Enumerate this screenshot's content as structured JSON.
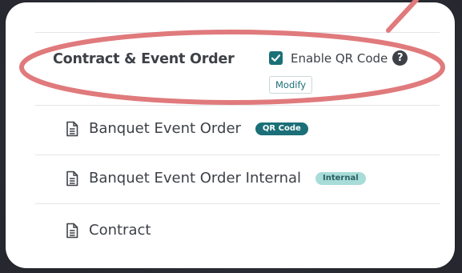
{
  "section": {
    "title": "Contract & Event Order",
    "qr_checkbox_label": "Enable QR Code",
    "qr_checked": true,
    "help_icon": "?",
    "modify_label": "Modify"
  },
  "documents": [
    {
      "label": "Banquet Event Order",
      "badge": "QR Code"
    },
    {
      "label": "Banquet Event Order Internal",
      "badge": "Internal"
    },
    {
      "label": "Contract",
      "badge": ""
    }
  ],
  "colors": {
    "accent": "#1b6f78",
    "internal_badge": "#a8dcd9",
    "annotation": "#e07a7c"
  },
  "icons": [
    "checkbox-check-icon",
    "help-icon",
    "document-icon"
  ]
}
